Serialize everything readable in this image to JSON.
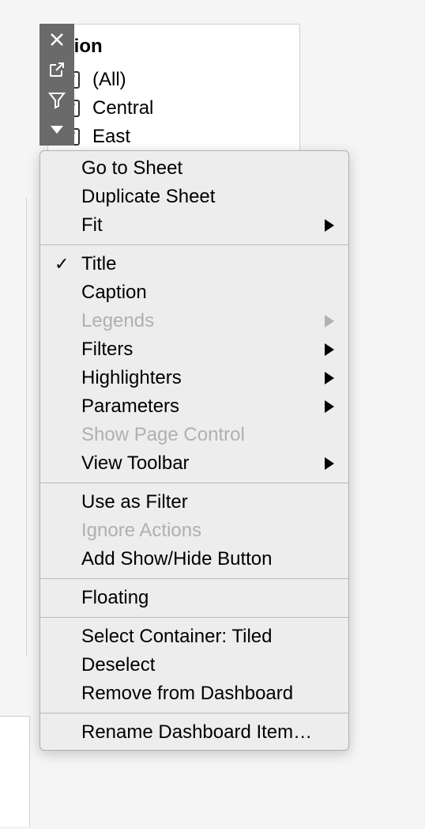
{
  "filter": {
    "title": "gion",
    "items": [
      {
        "label": "(All)",
        "checked": true
      },
      {
        "label": "Central",
        "checked": true
      },
      {
        "label": "East",
        "checked": true
      }
    ]
  },
  "menu": {
    "groups": [
      [
        {
          "label": "Go to Sheet",
          "enabled": true,
          "submenu": false,
          "checked": false
        },
        {
          "label": "Duplicate Sheet",
          "enabled": true,
          "submenu": false,
          "checked": false
        },
        {
          "label": "Fit",
          "enabled": true,
          "submenu": true,
          "checked": false
        }
      ],
      [
        {
          "label": "Title",
          "enabled": true,
          "submenu": false,
          "checked": true
        },
        {
          "label": "Caption",
          "enabled": true,
          "submenu": false,
          "checked": false
        },
        {
          "label": "Legends",
          "enabled": false,
          "submenu": true,
          "checked": false
        },
        {
          "label": "Filters",
          "enabled": true,
          "submenu": true,
          "checked": false
        },
        {
          "label": "Highlighters",
          "enabled": true,
          "submenu": true,
          "checked": false
        },
        {
          "label": "Parameters",
          "enabled": true,
          "submenu": true,
          "checked": false
        },
        {
          "label": "Show Page Control",
          "enabled": false,
          "submenu": false,
          "checked": false
        },
        {
          "label": "View Toolbar",
          "enabled": true,
          "submenu": true,
          "checked": false
        }
      ],
      [
        {
          "label": "Use as Filter",
          "enabled": true,
          "submenu": false,
          "checked": false
        },
        {
          "label": "Ignore Actions",
          "enabled": false,
          "submenu": false,
          "checked": false
        },
        {
          "label": "Add Show/Hide Button",
          "enabled": true,
          "submenu": false,
          "checked": false
        }
      ],
      [
        {
          "label": "Floating",
          "enabled": true,
          "submenu": false,
          "checked": false
        }
      ],
      [
        {
          "label": "Select Container: Tiled",
          "enabled": true,
          "submenu": false,
          "checked": false
        },
        {
          "label": "Deselect",
          "enabled": true,
          "submenu": false,
          "checked": false
        },
        {
          "label": "Remove from Dashboard",
          "enabled": true,
          "submenu": false,
          "checked": false
        }
      ],
      [
        {
          "label": "Rename Dashboard Item…",
          "enabled": true,
          "submenu": false,
          "checked": false
        }
      ]
    ]
  }
}
